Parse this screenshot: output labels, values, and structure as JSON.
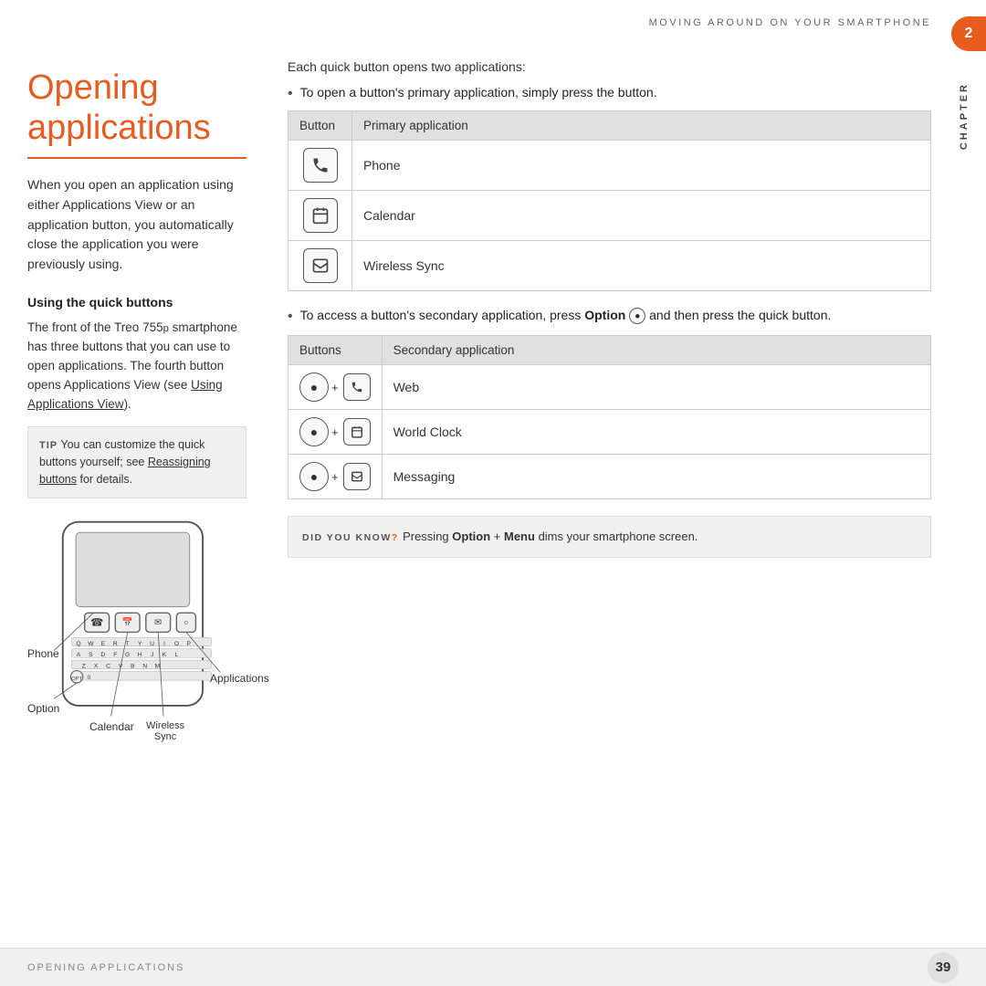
{
  "header": {
    "top_title": "MOVING AROUND ON YOUR SMARTPHONE",
    "chapter_number": "2",
    "chapter_label": "CHAPTER"
  },
  "left": {
    "page_title": "Opening applications",
    "intro_text": "When you open an application using either Applications View or an application button, you automatically close the application you were previously using.",
    "section_heading": "Using the quick buttons",
    "body_text": "The front of the Treo 755p smartphone has three buttons that you can use to open applications. The fourth button opens Applications View (see Using Applications View).",
    "tip_label": "TIP",
    "tip_text": "You can customize the quick buttons yourself; see Reassigning buttons for details.",
    "diagram_labels": {
      "phone": "Phone",
      "option": "Option",
      "calendar": "Calendar",
      "wireless_sync": "Wireless Sync",
      "applications": "Applications"
    }
  },
  "right": {
    "intro": "Each quick button opens two applications:",
    "bullet1": "To open a button's primary application, simply press the button.",
    "primary_table": {
      "col1": "Button",
      "col2": "Primary application",
      "rows": [
        {
          "app": "Phone"
        },
        {
          "app": "Calendar"
        },
        {
          "app": "Wireless Sync"
        }
      ]
    },
    "bullet2_before": "To access a button's secondary application, press",
    "bullet2_option": "Option",
    "bullet2_after": "and then press the quick button.",
    "secondary_table": {
      "col1": "Buttons",
      "col2": "Secondary application",
      "rows": [
        {
          "app": "Web"
        },
        {
          "app": "World Clock"
        },
        {
          "app": "Messaging"
        }
      ]
    },
    "dyk_label": "DID YOU KNOW",
    "dyk_question": "?",
    "dyk_text": "Pressing Option + Menu dims your smartphone screen."
  },
  "footer": {
    "left_text": "OPENING APPLICATIONS",
    "page_number": "39"
  }
}
